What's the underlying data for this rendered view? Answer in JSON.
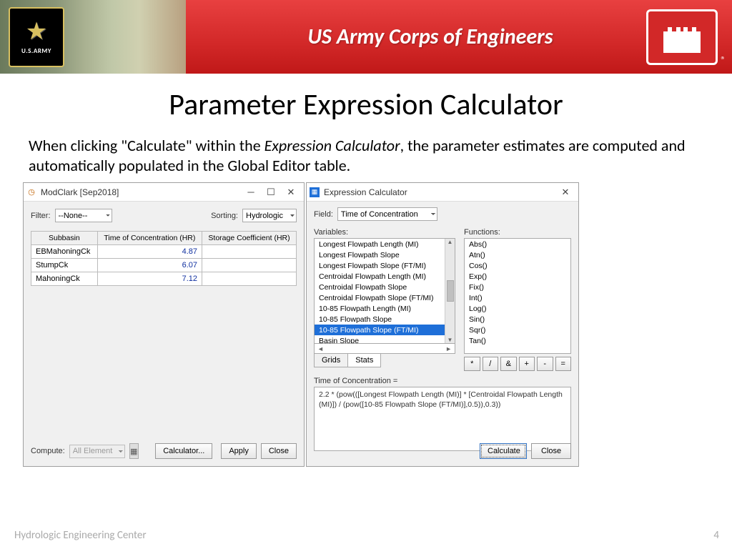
{
  "banner": {
    "army_sub": "U.S.ARMY",
    "corps_title": "US Army Corps of Engineers"
  },
  "slide": {
    "title": "Parameter Expression Calculator",
    "body": {
      "pre": "When clicking \"Calculate\" within the ",
      "ital": "Expression Calculator",
      "post": ", the parameter estimates are computed and automatically populated in the Global Editor table."
    }
  },
  "win1": {
    "title": "ModClark [Sep2018]",
    "filter_label": "Filter:",
    "filter_value": "--None--",
    "sorting_label": "Sorting:",
    "sorting_value": "Hydrologic",
    "cols": {
      "c1": "Subbasin",
      "c2": "Time of Concentration (HR)",
      "c3": "Storage Coefficient (HR)"
    },
    "rows": [
      {
        "name": "EBMahoningCk",
        "toc": "4.87",
        "sc": ""
      },
      {
        "name": "StumpCk",
        "toc": "6.07",
        "sc": ""
      },
      {
        "name": "MahoningCk",
        "toc": "7.12",
        "sc": ""
      }
    ],
    "compute_label": "Compute:",
    "compute_value": "All Elements",
    "calculator_btn": "Calculator...",
    "apply_btn": "Apply",
    "close_btn": "Close"
  },
  "win2": {
    "title": "Expression Calculator",
    "field_label": "Field:",
    "field_value": "Time of Concentration",
    "variables_label": "Variables:",
    "variables": [
      "Longest Flowpath Length (MI)",
      "Longest Flowpath Slope",
      "Longest Flowpath Slope (FT/MI)",
      "Centroidal Flowpath Length (MI)",
      "Centroidal Flowpath Slope",
      "Centroidal Flowpath Slope (FT/MI)",
      "10-85 Flowpath Length (MI)",
      "10-85 Flowpath Slope",
      "10-85 Flowpath Slope (FT/MI)",
      "Basin Slope"
    ],
    "selected_var_index": 8,
    "functions_label": "Functions:",
    "functions": [
      "Abs()",
      "Atn()",
      "Cos()",
      "Exp()",
      "Fix()",
      "Int()",
      "Log()",
      "Sin()",
      "Sqr()",
      "Tan()"
    ],
    "tabs": {
      "grids": "Grids",
      "stats": "Stats"
    },
    "ops": [
      "*",
      "/",
      "&",
      "+",
      "-",
      "="
    ],
    "expr_label": "Time of Concentration =",
    "expr": "2.2 * (pow(([Longest Flowpath Length (MI)] * [Centroidal Flowpath Length (MI)]) / (pow([10-85 Flowpath Slope (FT/MI)],0.5)),0.3))",
    "calculate_btn": "Calculate",
    "close_btn": "Close"
  },
  "footer": {
    "left": "Hydrologic Engineering Center",
    "right": "4"
  }
}
